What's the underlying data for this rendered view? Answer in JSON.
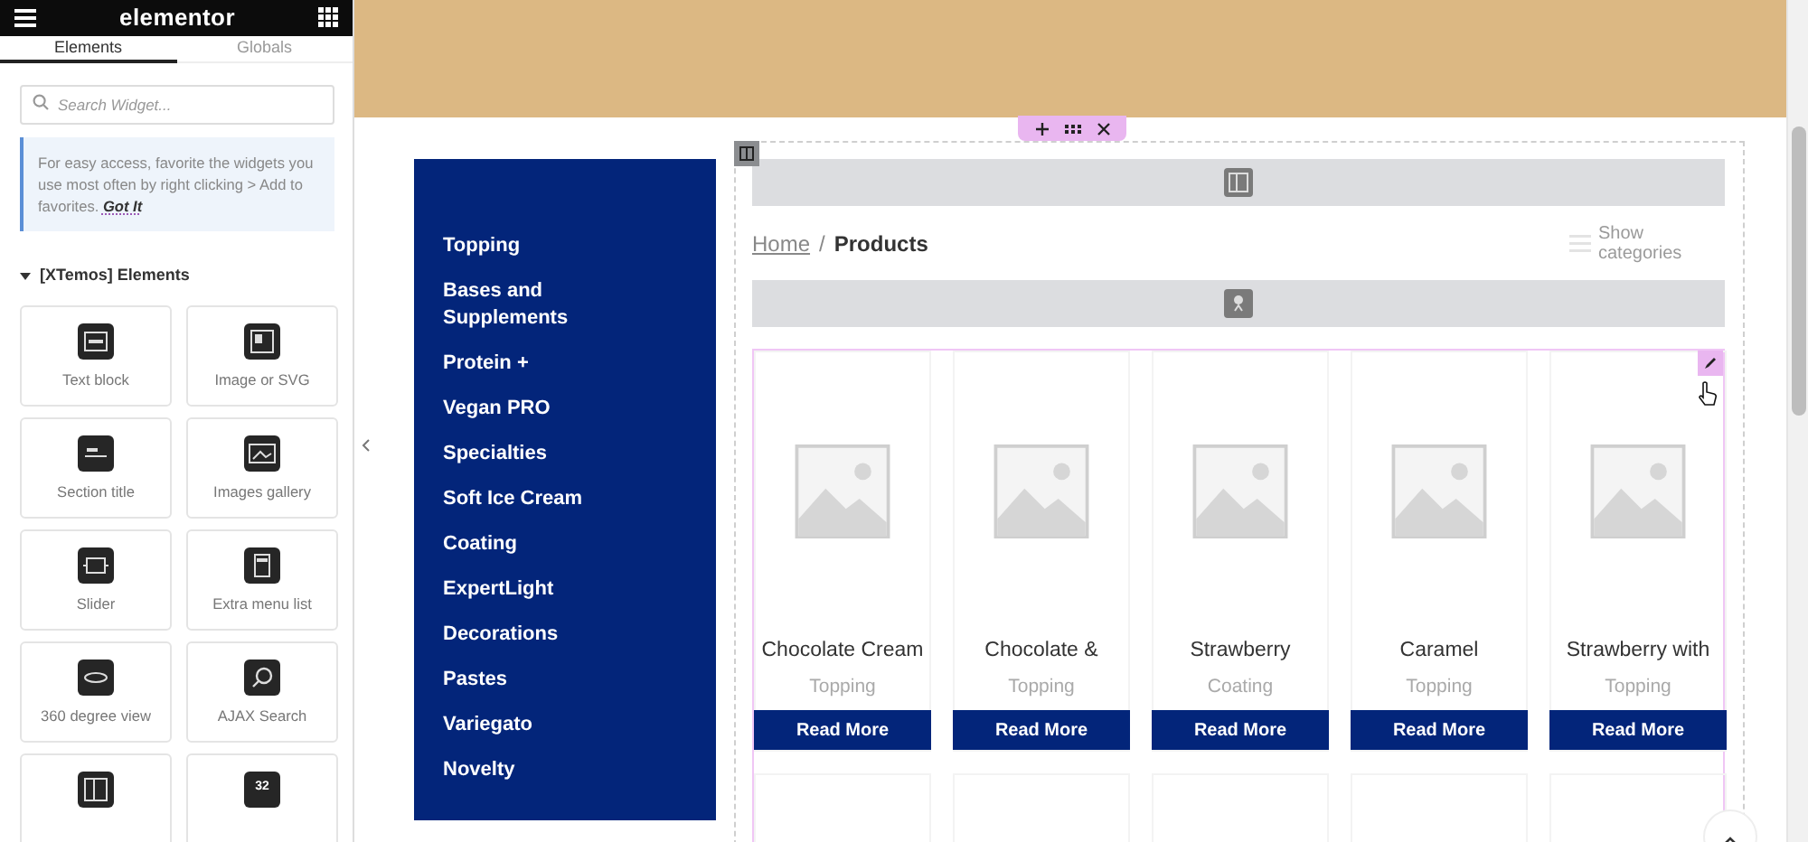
{
  "panel": {
    "title": "elementor",
    "tabs": [
      {
        "label": "Elements",
        "selected": true
      },
      {
        "label": "Globals",
        "selected": false
      }
    ],
    "search": {
      "placeholder": "Search Widget..."
    },
    "notice": {
      "text": "For easy access, favorite the widgets you use most often by right clicking > Add to favorites.",
      "link": "Got It"
    },
    "section": {
      "title": "[XTemos] Elements",
      "expanded": true
    },
    "widgets": [
      {
        "kind": "text",
        "label": "Text block"
      },
      {
        "kind": "image",
        "label": "Image or SVG"
      },
      {
        "kind": "title",
        "label": "Section title"
      },
      {
        "kind": "gallery",
        "label": "Images gallery"
      },
      {
        "kind": "slider",
        "label": "Slider"
      },
      {
        "kind": "menu",
        "label": "Extra menu list"
      },
      {
        "kind": "view360",
        "label": "360 degree view"
      },
      {
        "kind": "search",
        "label": "AJAX Search"
      },
      {
        "kind": "layout"
      },
      {
        "kind": "counter",
        "icon_text": "32"
      }
    ]
  },
  "canvas": {
    "categories": [
      "Topping",
      "Bases and Supplements",
      "Protein +",
      "Vegan PRO",
      "Specialties",
      "Soft Ice Cream",
      "Coating",
      "ExpertLight",
      "Decorations",
      "Pastes",
      "Variegato",
      "Novelty"
    ],
    "breadcrumb": [
      "Home",
      "Products"
    ],
    "breadcrumb_separator": "/",
    "show_categories": "Show categories",
    "products": [
      {
        "name": "Chocolate Cream",
        "category": "Topping",
        "button": "Read More"
      },
      {
        "name": "Chocolate &",
        "category": "Topping",
        "button": "Read More"
      },
      {
        "name": "Strawberry",
        "category": "Coating",
        "button": "Read More"
      },
      {
        "name": "Caramel",
        "category": "Topping",
        "button": "Read More"
      },
      {
        "name": "Strawberry with",
        "category": "Topping",
        "button": "Read More"
      }
    ]
  }
}
